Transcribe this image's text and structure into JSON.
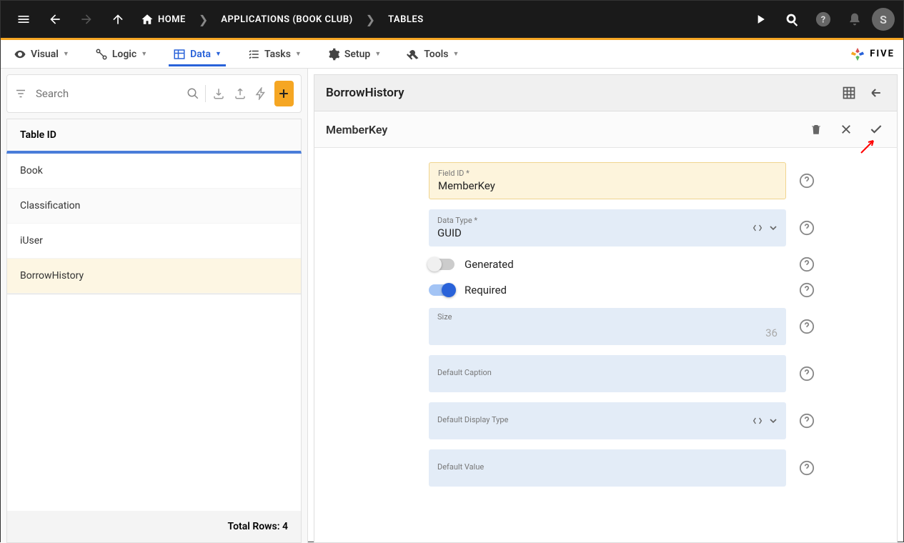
{
  "topbar": {
    "home": "HOME",
    "applications": "APPLICATIONS (BOOK CLUB)",
    "tables": "TABLES",
    "avatar": "S"
  },
  "menubar": {
    "visual": "Visual",
    "logic": "Logic",
    "data": "Data",
    "tasks": "Tasks",
    "setup": "Setup",
    "tools": "Tools",
    "brand": "FIVE"
  },
  "left": {
    "search_placeholder": "Search",
    "list_header": "Table ID",
    "rows": [
      "Book",
      "Classification",
      "iUser",
      "BorrowHistory"
    ],
    "total_label": "Total Rows: 4"
  },
  "right": {
    "title": "BorrowHistory",
    "subtitle": "MemberKey"
  },
  "form": {
    "field_id_label": "Field ID *",
    "field_id_value": "MemberKey",
    "data_type_label": "Data Type *",
    "data_type_value": "GUID",
    "generated_label": "Generated",
    "generated_on": false,
    "required_label": "Required",
    "required_on": true,
    "size_label": "Size",
    "size_value": "36",
    "default_caption_label": "Default Caption",
    "default_caption_value": "",
    "default_display_type_label": "Default Display Type",
    "default_display_type_value": "",
    "default_value_label": "Default Value",
    "default_value_value": ""
  }
}
